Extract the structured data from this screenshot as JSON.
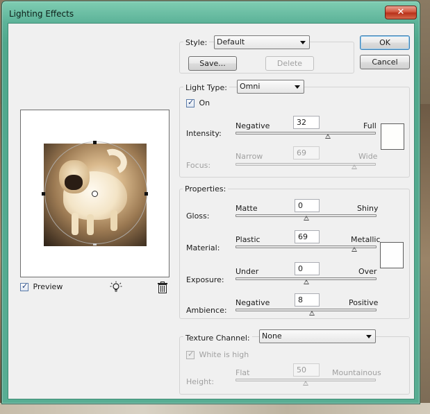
{
  "window": {
    "title": "Lighting Effects",
    "close_glyph": "✕"
  },
  "style_group": {
    "label": "Style:",
    "selected": "Default",
    "save_label": "Save...",
    "delete_label": "Delete"
  },
  "buttons": {
    "ok_label": "OK",
    "cancel_label": "Cancel"
  },
  "light_type": {
    "label": "Light Type:",
    "selected": "Omni",
    "on_label": "On",
    "on_checked": true,
    "intensity": {
      "label": "Intensity:",
      "min_label": "Negative",
      "max_label": "Full",
      "value": "32",
      "fraction": 0.55
    },
    "focus": {
      "label": "Focus:",
      "min_label": "Narrow",
      "max_label": "Wide",
      "value": "69",
      "fraction": 0.84,
      "disabled": true
    },
    "swatch_color": "#fefefc"
  },
  "properties": {
    "title": "Properties:",
    "gloss": {
      "label": "Gloss:",
      "min_label": "Matte",
      "max_label": "Shiny",
      "value": "0",
      "fraction": 0.5
    },
    "material": {
      "label": "Material:",
      "min_label": "Plastic",
      "max_label": "Metallic",
      "value": "69",
      "fraction": 0.84
    },
    "exposure": {
      "label": "Exposure:",
      "min_label": "Under",
      "max_label": "Over",
      "value": "0",
      "fraction": 0.5
    },
    "ambience": {
      "label": "Ambience:",
      "min_label": "Negative",
      "max_label": "Positive",
      "value": "8",
      "fraction": 0.54
    },
    "swatch_color": "#fefefe"
  },
  "texture": {
    "label": "Texture Channel:",
    "selected": "None",
    "white_is_high_label": "White is high",
    "white_is_high_checked": true,
    "height": {
      "label": "Height:",
      "min_label": "Flat",
      "max_label": "Mountainous",
      "value": "50",
      "fraction": 0.5,
      "disabled": true
    }
  },
  "preview": {
    "label": "Preview",
    "checked": true,
    "bulb_icon": "light-bulb-icon",
    "trash_icon": "trash-icon"
  }
}
